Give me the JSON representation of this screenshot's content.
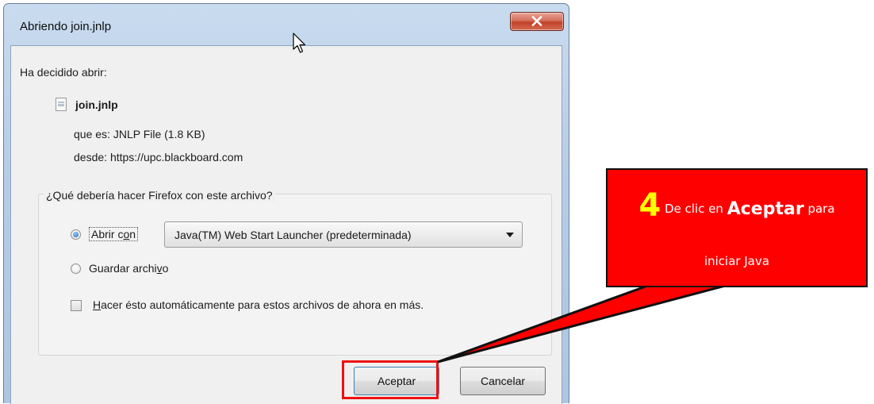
{
  "dialog": {
    "title": "Abriendo join.jnlp",
    "heading": "Ha decidido abrir:",
    "file_name": "join.jnlp",
    "type_label": "que es:",
    "type_value": "JNLP File (1.8 KB)",
    "from_label": "desde:",
    "from_value": "https://upc.blackboard.com",
    "question": "¿Qué debería hacer Firefox con este archivo?",
    "open_with": {
      "label_start": "Abrir c",
      "label_access": "o",
      "label_end": "n",
      "checked": true
    },
    "app_select": {
      "value": "Java(TM) Web Start Launcher (predeterminada)"
    },
    "save_file": {
      "label_start": "Guardar archi",
      "label_access": "v",
      "label_end": "o",
      "checked": false
    },
    "auto_checkbox": {
      "label_access": "H",
      "label_rest": "acer ésto automáticamente para estos archivos de ahora en más.",
      "checked": false
    },
    "ok_label": "Aceptar",
    "cancel_label": "Cancelar"
  },
  "callout": {
    "step": "4",
    "text_before": "De clic en",
    "text_bold": "Aceptar",
    "text_after": "para",
    "line2": "iniciar Java",
    "background": "#ff0000",
    "step_color": "#ffff00"
  },
  "colors": {
    "highlight": "#ee1111",
    "titlebar": "#b7cde6",
    "close_button": "#c2412b"
  },
  "icons": [
    "close-icon",
    "file-icon",
    "dropdown-arrow-icon",
    "mouse-pointer-icon"
  ]
}
